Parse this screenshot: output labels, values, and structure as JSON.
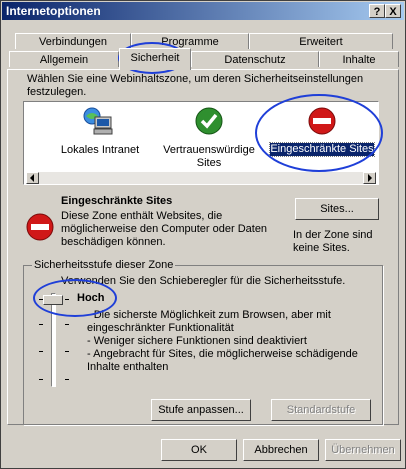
{
  "window": {
    "title": "Internetoptionen",
    "help_btn": "?",
    "close_btn": "X"
  },
  "tabs": {
    "row1": [
      "Verbindungen",
      "Programme",
      "Erweitert"
    ],
    "row2": [
      "Allgemein",
      "Sicherheit",
      "Datenschutz",
      "Inhalte"
    ],
    "active": "Sicherheit"
  },
  "zones": {
    "intro": "Wählen Sie eine Webinhaltszone, um deren Sicherheitseinstellungen festzulegen.",
    "items": [
      {
        "label": "Lokales Intranet",
        "icon": "intranet-icon"
      },
      {
        "label": "Vertrauenswürdige Sites",
        "icon": "trusted-check-icon"
      },
      {
        "label": "Eingeschränkte Sites",
        "icon": "restricted-icon",
        "selected": true
      }
    ]
  },
  "selected_zone": {
    "title": "Eingeschränkte Sites",
    "description": "Diese Zone enthält Websites, die möglicherweise den Computer oder Daten beschädigen können.",
    "sites_button": "Sites...",
    "sites_note": "In der Zone sind keine Sites."
  },
  "security_level": {
    "group_title": "Sicherheitsstufe dieser Zone",
    "instruction": "Verwenden Sie den Schieberegler für die Sicherheitsstufe.",
    "level": "Hoch",
    "bullets": [
      "- Die sicherste Möglichkeit zum Browsen, aber mit eingeschränkter Funktionalität",
      "- Weniger sichere Funktionen sind deaktiviert",
      "- Angebracht für Sites, die möglicherweise schädigende Inhalte enthalten"
    ],
    "custom_button": "Stufe anpassen...",
    "default_button": "Standardstufe"
  },
  "footer": {
    "ok": "OK",
    "cancel": "Abbrechen",
    "apply": "Übernehmen"
  },
  "colors": {
    "titlebar": "#0a246a",
    "annotation": "#1f3fd8",
    "restricted_red": "#d01818",
    "trusted_green": "#2f8f2f"
  }
}
